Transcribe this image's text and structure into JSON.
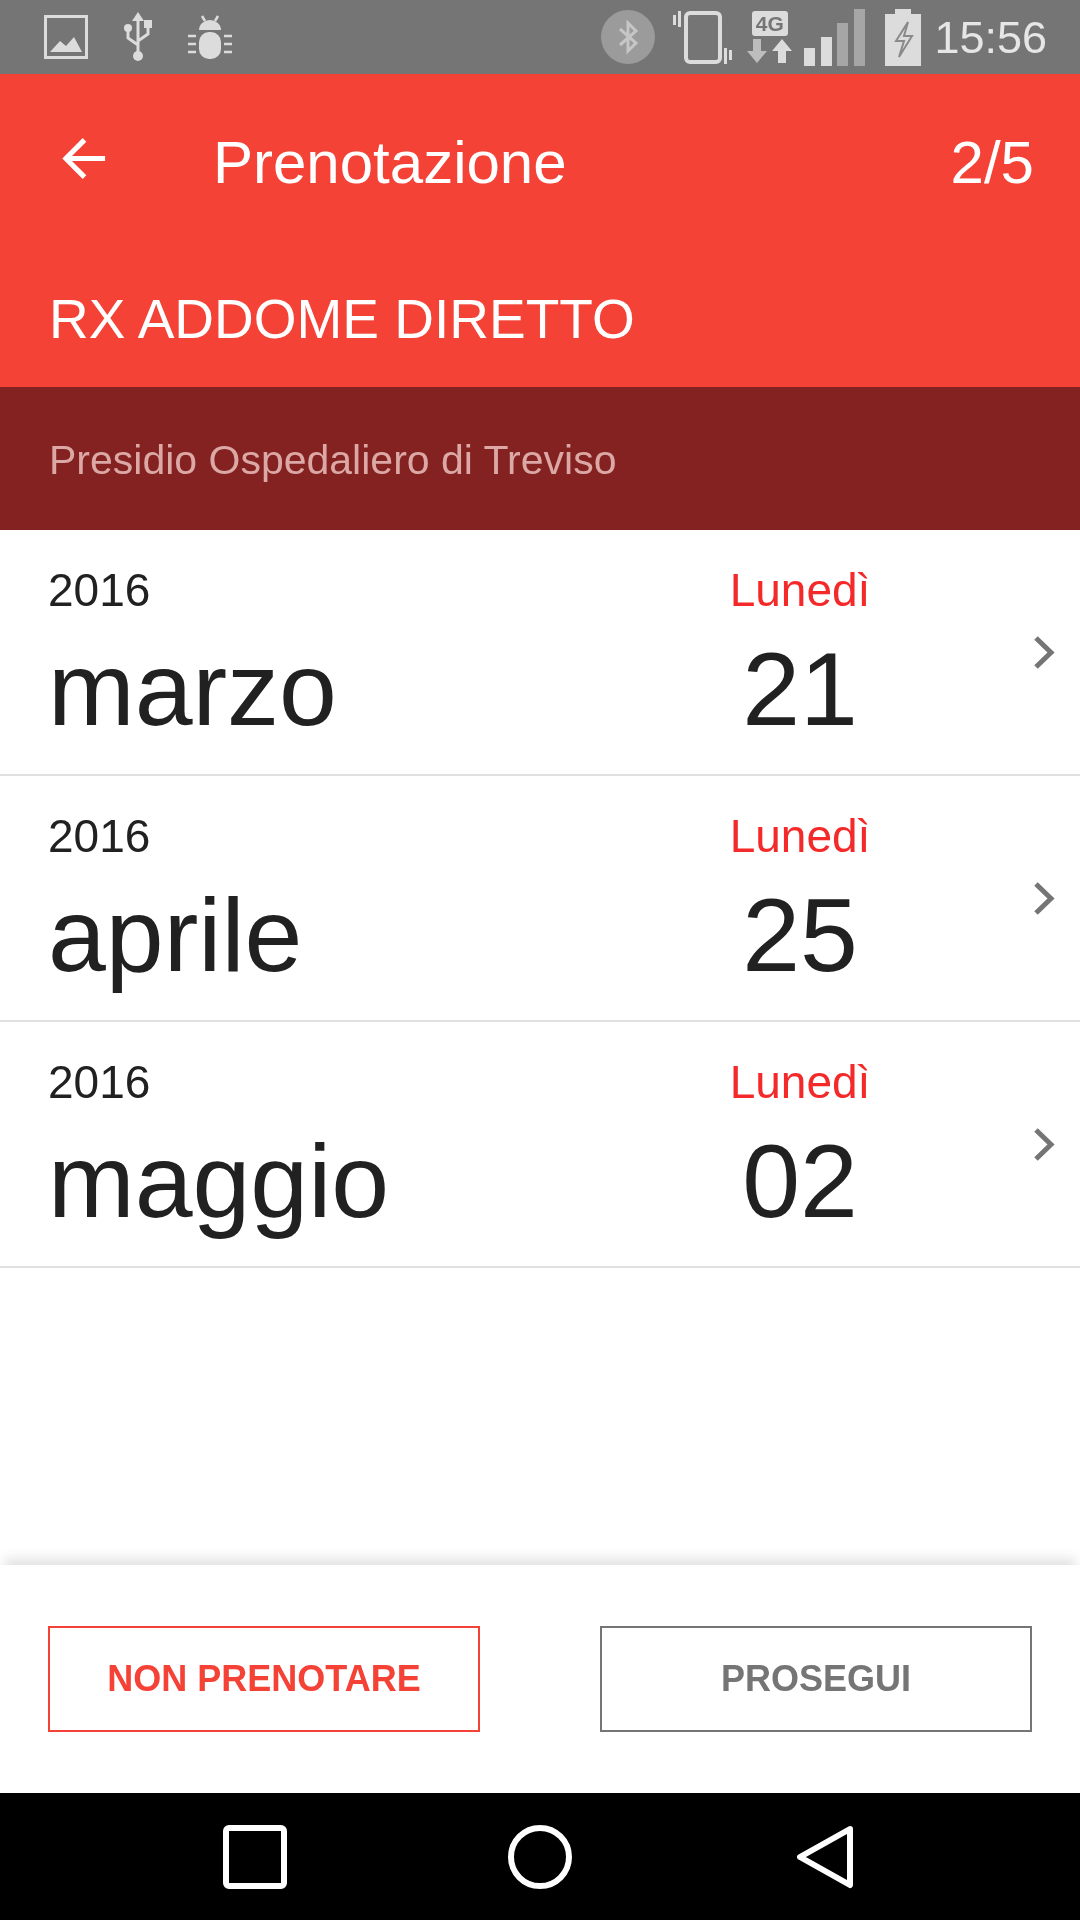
{
  "status_bar": {
    "network_type": "4G",
    "time": "15:56"
  },
  "toolbar": {
    "title": "Prenotazione",
    "step": "2/5",
    "exam": "RX ADDOME DIRETTO"
  },
  "location": "Presidio Ospedaliero di Treviso",
  "dates": [
    {
      "year": "2016",
      "month": "marzo",
      "weekday": "Lunedì",
      "day": "21"
    },
    {
      "year": "2016",
      "month": "aprile",
      "weekday": "Lunedì",
      "day": "25"
    },
    {
      "year": "2016",
      "month": "maggio",
      "weekday": "Lunedì",
      "day": "02"
    }
  ],
  "buttons": [
    {
      "label": "NON PRENOTARE",
      "kind": "danger"
    },
    {
      "label": "PROSEGUI",
      "kind": "neutral"
    }
  ]
}
